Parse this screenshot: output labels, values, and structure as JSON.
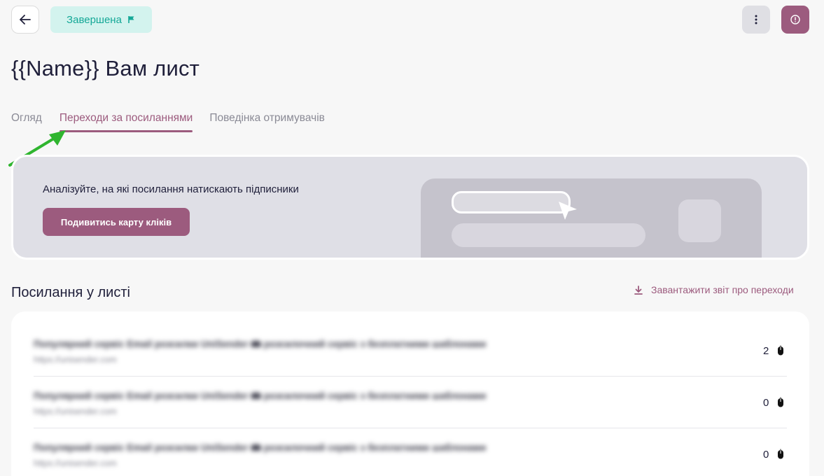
{
  "header": {
    "status_label": "Завершена",
    "title": "{{Name}} Вам лист"
  },
  "tabs": [
    {
      "label": "Огляд",
      "active": false
    },
    {
      "label": "Переходи за посиланнями",
      "active": true
    },
    {
      "label": "Поведінка отримувачів",
      "active": false
    }
  ],
  "promo": {
    "text": "Аналізуйте, на які посилання натискають підписники",
    "button_label": "Подивитись карту кліків"
  },
  "links_section": {
    "title": "Посилання у листі",
    "download_label": "Завантажити звіт про переходи",
    "rows": [
      {
        "title": "Популярний сервіс Email розсилки UniSender 📾 розсилочний сервіс з безплатними шаблонами",
        "url": "https://unisender.com",
        "count": "2"
      },
      {
        "title": "Популярний сервіс Email розсилки UniSender 📾 розсилочний сервіс з безплатними шаблонами",
        "url": "https://unisender.com",
        "count": "0"
      },
      {
        "title": "Популярний сервіс Email розсилки UniSender 📾 розсилочний сервіс з безплатними шаблонами",
        "url": "https://unisender.com",
        "count": "0"
      }
    ]
  },
  "colors": {
    "accent": "#9c5b7e",
    "status_bg": "#d3f3ee",
    "status_text": "#14a897",
    "annotation_arrow": "#2fb52f"
  },
  "icons": {
    "back": "arrow-left-icon",
    "status": "flag-icon",
    "menu": "kebab-menu-icon",
    "info": "info-icon",
    "download": "download-icon",
    "clicks": "mouse-icon"
  }
}
